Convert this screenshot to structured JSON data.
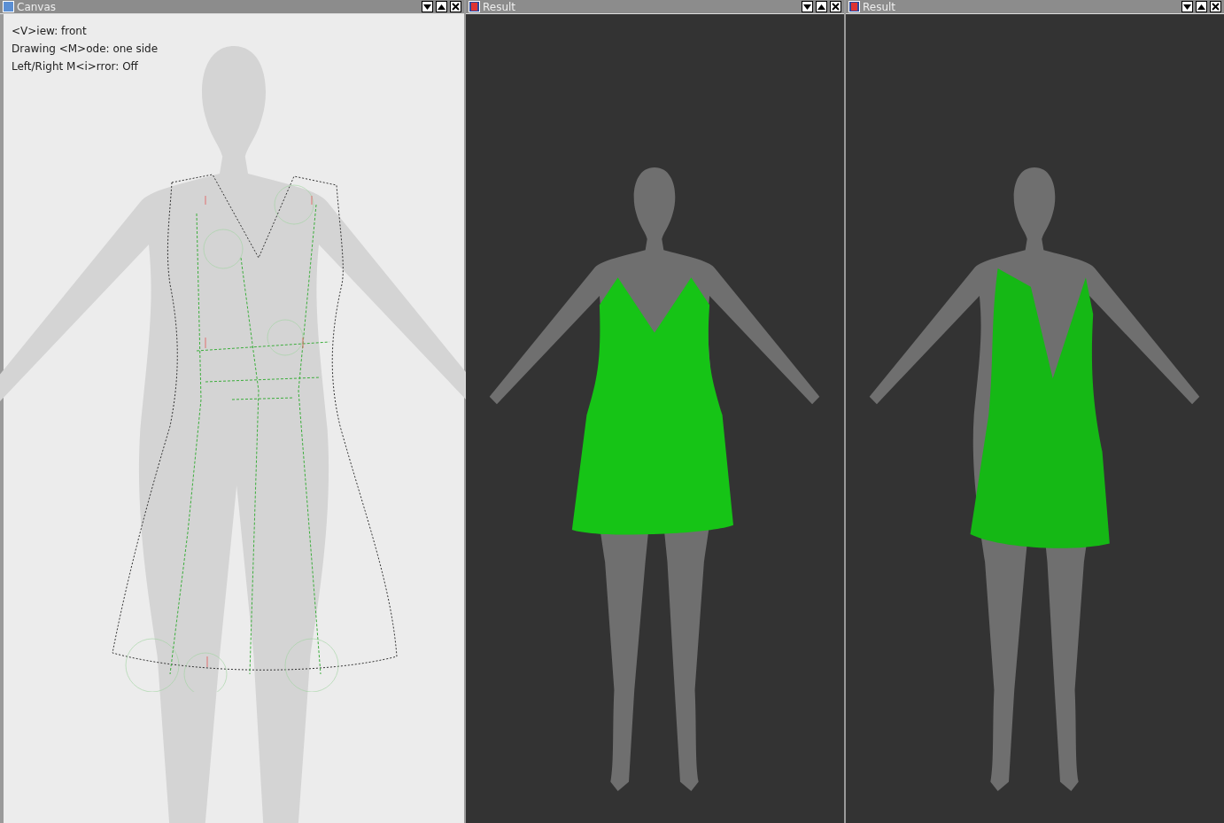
{
  "windows": [
    {
      "kind": "canvas",
      "title": "Canvas",
      "overlay_lines": [
        "<V>iew: front",
        "Drawing <M>ode: one side",
        "Left/Right M<i>rror: Off"
      ]
    },
    {
      "kind": "result",
      "title": "Result",
      "facing_away": false
    },
    {
      "kind": "result",
      "title": "Result",
      "facing_away": true
    }
  ]
}
